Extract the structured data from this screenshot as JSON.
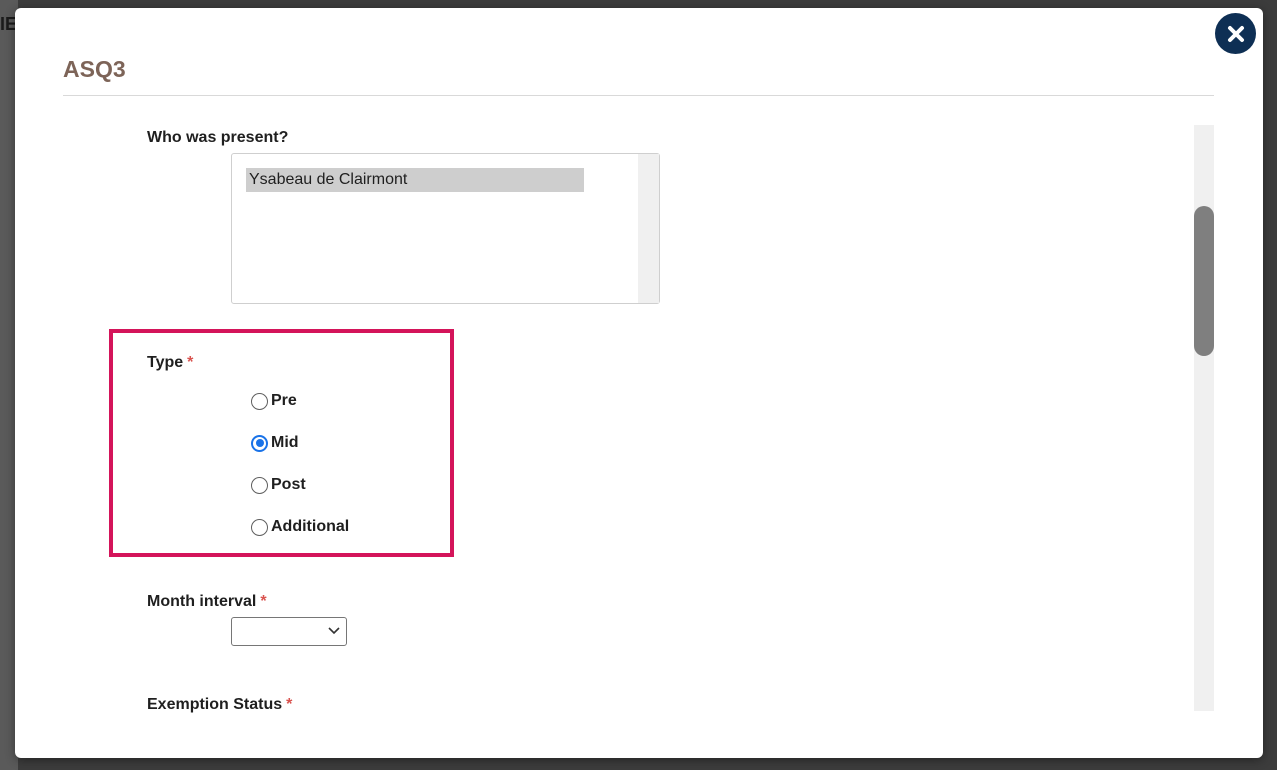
{
  "backdrop": {
    "partial_text": "IE"
  },
  "modal": {
    "title": "ASQ3",
    "close_icon": "close-x-icon",
    "accent_colors": {
      "title": "#7d6458",
      "close_button": "#0e2f54",
      "highlight": "#d4145a",
      "radio_checked": "#1a73e8",
      "required": "#d9534f"
    }
  },
  "form": {
    "who_present": {
      "label": "Who was present?",
      "options": [
        "Ysabeau de Clairmont"
      ]
    },
    "type": {
      "label": "Type",
      "required_mark": "*",
      "options": [
        {
          "label": "Pre",
          "checked": false
        },
        {
          "label": "Mid",
          "checked": true
        },
        {
          "label": "Post",
          "checked": false
        },
        {
          "label": "Additional",
          "checked": false
        }
      ]
    },
    "month_interval": {
      "label": "Month interval",
      "required_mark": "*",
      "value": ""
    },
    "exemption_status": {
      "label": "Exemption Status",
      "required_mark": "*"
    }
  }
}
